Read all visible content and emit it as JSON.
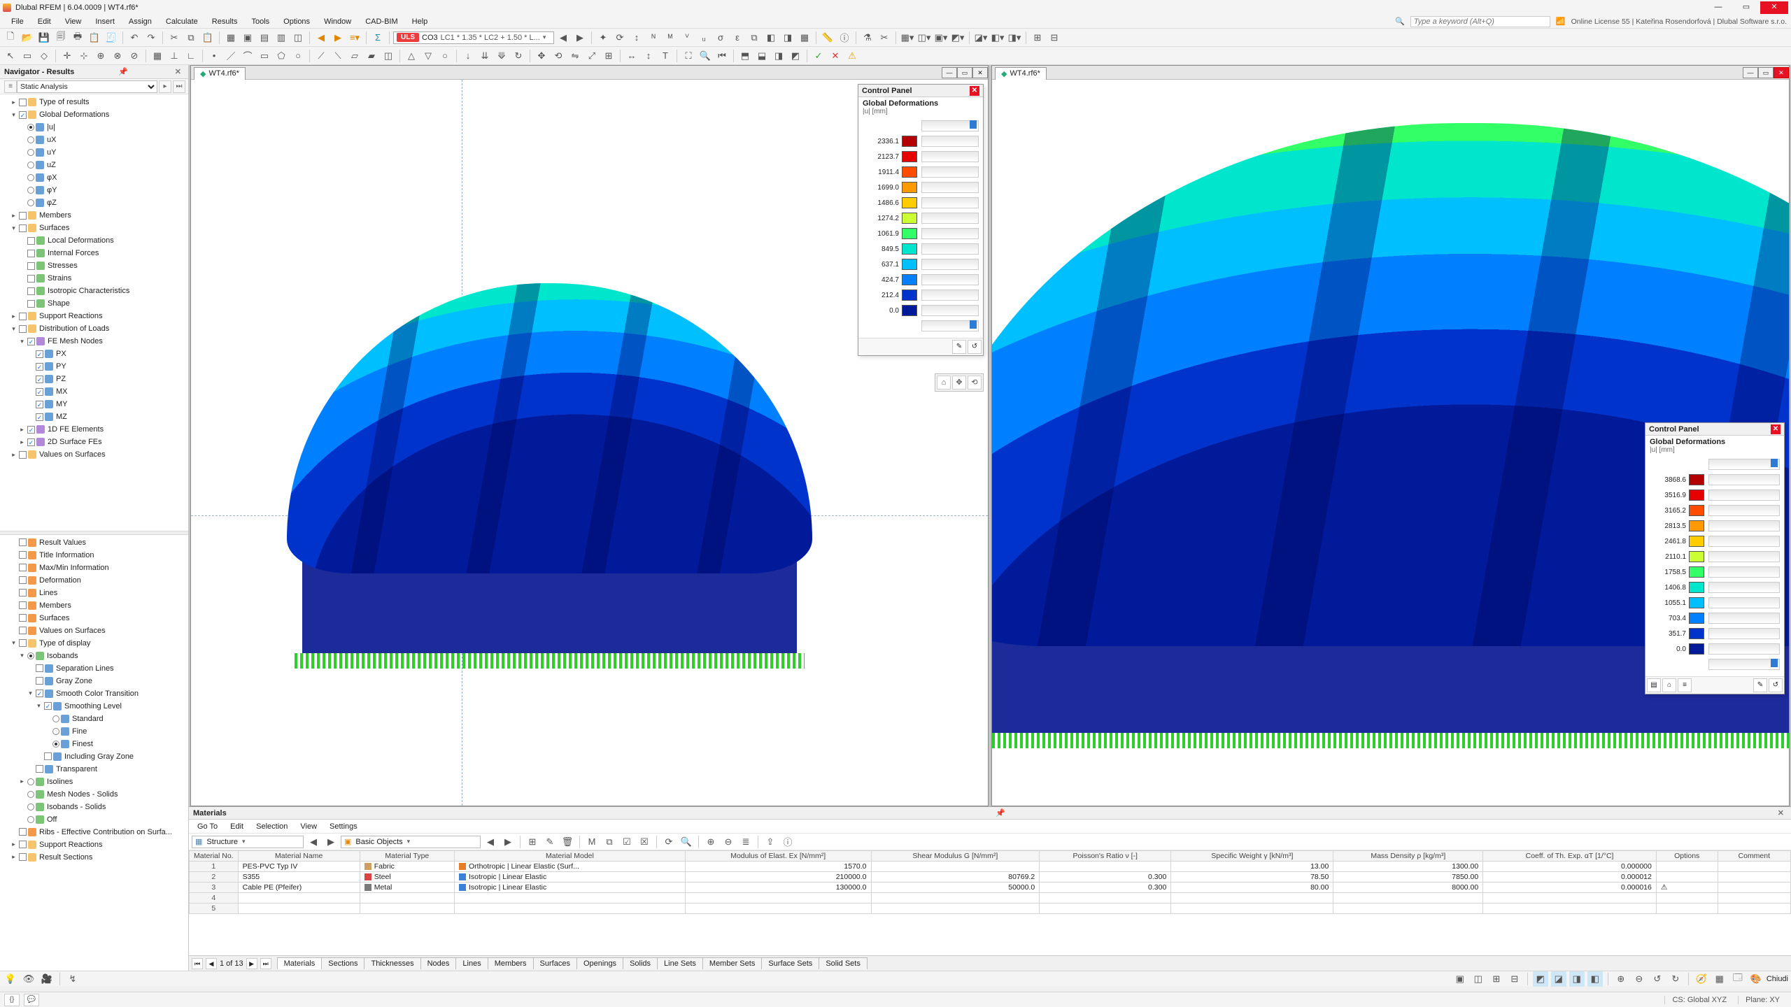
{
  "app": {
    "title": "Dlubal RFEM | 6.04.0009 | WT4.rf6*"
  },
  "license": "Online License 55 | Kateřina Rosendorfová | Dlubal Software s.r.o.",
  "search_placeholder": "Type a keyword (Alt+Q)",
  "menus": [
    "File",
    "Edit",
    "View",
    "Insert",
    "Assign",
    "Calculate",
    "Results",
    "Tools",
    "Options",
    "Window",
    "CAD-BIM",
    "Help"
  ],
  "load_combo": {
    "badge": "ULS",
    "code": "CO3",
    "text": "LC1 * 1.35 * LC2 + 1.50 * L..."
  },
  "navigator": {
    "title": "Navigator - Results",
    "analysis_type": "Static Analysis",
    "tree_top": [
      {
        "lvl": 1,
        "exp": ">",
        "chk": "",
        "ic": "folder",
        "lbl": "Type of results"
      },
      {
        "lvl": 1,
        "exp": "v",
        "chk": "c",
        "ic": "folder",
        "lbl": "Global Deformations"
      },
      {
        "lvl": 2,
        "radio": "c",
        "ic": "blue",
        "lbl": "|u|"
      },
      {
        "lvl": 2,
        "radio": "",
        "ic": "blue",
        "lbl": "uX"
      },
      {
        "lvl": 2,
        "radio": "",
        "ic": "blue",
        "lbl": "uY"
      },
      {
        "lvl": 2,
        "radio": "",
        "ic": "blue",
        "lbl": "uZ"
      },
      {
        "lvl": 2,
        "radio": "",
        "ic": "blue",
        "lbl": "φX"
      },
      {
        "lvl": 2,
        "radio": "",
        "ic": "blue",
        "lbl": "φY"
      },
      {
        "lvl": 2,
        "radio": "",
        "ic": "blue",
        "lbl": "φZ"
      },
      {
        "lvl": 1,
        "exp": ">",
        "chk": "",
        "ic": "folder",
        "lbl": "Members"
      },
      {
        "lvl": 1,
        "exp": "v",
        "chk": "",
        "ic": "folder",
        "lbl": "Surfaces"
      },
      {
        "lvl": 2,
        "chk": "",
        "ic": "green",
        "lbl": "Local Deformations"
      },
      {
        "lvl": 2,
        "chk": "",
        "ic": "green",
        "lbl": "Internal Forces"
      },
      {
        "lvl": 2,
        "chk": "",
        "ic": "green",
        "lbl": "Stresses"
      },
      {
        "lvl": 2,
        "chk": "",
        "ic": "green",
        "lbl": "Strains"
      },
      {
        "lvl": 2,
        "chk": "",
        "ic": "green",
        "lbl": "Isotropic Characteristics"
      },
      {
        "lvl": 2,
        "chk": "",
        "ic": "green",
        "lbl": "Shape"
      },
      {
        "lvl": 1,
        "exp": ">",
        "chk": "",
        "ic": "folder",
        "lbl": "Support Reactions"
      },
      {
        "lvl": 1,
        "exp": "v",
        "chk": "",
        "ic": "folder",
        "lbl": "Distribution of Loads"
      },
      {
        "lvl": 2,
        "exp": "v",
        "chk": "c",
        "ic": "mesh",
        "lbl": "FE Mesh Nodes"
      },
      {
        "lvl": 3,
        "chk": "c",
        "ic": "blue",
        "lbl": "PX"
      },
      {
        "lvl": 3,
        "chk": "c",
        "ic": "blue",
        "lbl": "PY"
      },
      {
        "lvl": 3,
        "chk": "c",
        "ic": "blue",
        "lbl": "PZ"
      },
      {
        "lvl": 3,
        "chk": "c",
        "ic": "blue",
        "lbl": "MX"
      },
      {
        "lvl": 3,
        "chk": "c",
        "ic": "blue",
        "lbl": "MY"
      },
      {
        "lvl": 3,
        "chk": "c",
        "ic": "blue",
        "lbl": "MZ"
      },
      {
        "lvl": 2,
        "exp": ">",
        "chk": "c",
        "ic": "mesh",
        "lbl": "1D FE Elements"
      },
      {
        "lvl": 2,
        "exp": ">",
        "chk": "c",
        "ic": "mesh",
        "lbl": "2D Surface FEs"
      },
      {
        "lvl": 1,
        "exp": ">",
        "chk": "",
        "ic": "folder",
        "lbl": "Values on Surfaces"
      }
    ],
    "tree_bottom": [
      {
        "lvl": 1,
        "chk": "",
        "ic": "orange",
        "lbl": "Result Values"
      },
      {
        "lvl": 1,
        "chk": "",
        "ic": "orange",
        "lbl": "Title Information"
      },
      {
        "lvl": 1,
        "chk": "",
        "ic": "orange",
        "lbl": "Max/Min Information"
      },
      {
        "lvl": 1,
        "chk": "",
        "ic": "orange",
        "lbl": "Deformation"
      },
      {
        "lvl": 1,
        "chk": "",
        "ic": "orange",
        "lbl": "Lines"
      },
      {
        "lvl": 1,
        "chk": "",
        "ic": "orange",
        "lbl": "Members"
      },
      {
        "lvl": 1,
        "chk": "",
        "ic": "orange",
        "lbl": "Surfaces"
      },
      {
        "lvl": 1,
        "chk": "",
        "ic": "orange",
        "lbl": "Values on Surfaces"
      },
      {
        "lvl": 1,
        "exp": "v",
        "chk": "",
        "ic": "folder",
        "lbl": "Type of display"
      },
      {
        "lvl": 2,
        "exp": "v",
        "radio": "c",
        "ic": "green",
        "lbl": "Isobands"
      },
      {
        "lvl": 3,
        "chk": "",
        "ic": "blue",
        "lbl": "Separation Lines"
      },
      {
        "lvl": 3,
        "chk": "",
        "ic": "blue",
        "lbl": "Gray Zone"
      },
      {
        "lvl": 3,
        "exp": "v",
        "chk": "c",
        "ic": "blue",
        "lbl": "Smooth Color Transition"
      },
      {
        "lvl": 4,
        "exp": "v",
        "chk": "c",
        "ic": "blue",
        "lbl": "Smoothing Level"
      },
      {
        "lvl": 5,
        "radio": "",
        "ic": "blue",
        "lbl": "Standard"
      },
      {
        "lvl": 5,
        "radio": "",
        "ic": "blue",
        "lbl": "Fine"
      },
      {
        "lvl": 5,
        "radio": "c",
        "ic": "blue",
        "lbl": "Finest"
      },
      {
        "lvl": 4,
        "chk": "",
        "ic": "blue",
        "lbl": "Including Gray Zone"
      },
      {
        "lvl": 3,
        "chk": "",
        "ic": "blue",
        "lbl": "Transparent"
      },
      {
        "lvl": 2,
        "exp": ">",
        "radio": "",
        "ic": "green",
        "lbl": "Isolines"
      },
      {
        "lvl": 2,
        "radio": "",
        "ic": "green",
        "lbl": "Mesh Nodes - Solids"
      },
      {
        "lvl": 2,
        "radio": "",
        "ic": "green",
        "lbl": "Isobands - Solids"
      },
      {
        "lvl": 2,
        "radio": "",
        "ic": "green",
        "lbl": "Off"
      },
      {
        "lvl": 1,
        "chk": "",
        "ic": "orange",
        "lbl": "Ribs - Effective Contribution on Surfa..."
      },
      {
        "lvl": 1,
        "exp": ">",
        "chk": "",
        "ic": "folder",
        "lbl": "Support Reactions"
      },
      {
        "lvl": 1,
        "exp": ">",
        "chk": "",
        "ic": "folder",
        "lbl": "Result Sections"
      }
    ]
  },
  "view": {
    "tab": "WT4.rf6*"
  },
  "control_panels": {
    "left": {
      "title": "Control Panel",
      "subtitle": "Global Deformations",
      "unit": "|u| [mm]",
      "values": [
        "2336.1",
        "2123.7",
        "1911.4",
        "1699.0",
        "1486.6",
        "1274.2",
        "1061.9",
        "849.5",
        "637.1",
        "424.7",
        "212.4",
        "0.0"
      ]
    },
    "right": {
      "title": "Control Panel",
      "subtitle": "Global Deformations",
      "unit": "|u| [mm]",
      "values": [
        "3868.6",
        "3516.9",
        "3165.2",
        "2813.5",
        "2461.8",
        "2110.1",
        "1758.5",
        "1406.8",
        "1055.1",
        "703.4",
        "351.7",
        "0.0"
      ]
    }
  },
  "scale_colors": [
    "#b30000",
    "#e60000",
    "#ff4d00",
    "#ff9900",
    "#ffcc00",
    "#ccff33",
    "#33ff66",
    "#00e6cc",
    "#00bfff",
    "#0080ff",
    "#0033cc",
    "#001a99"
  ],
  "materials": {
    "title": "Materials",
    "menus": [
      "Go To",
      "Edit",
      "Selection",
      "View",
      "Settings"
    ],
    "combo1": "Structure",
    "combo2": "Basic Objects",
    "headers": [
      "Material No.",
      "Material Name",
      "Material Type",
      "Material Model",
      "Modulus of Elast. Ex [N/mm²]",
      "Shear Modulus G [N/mm²]",
      "Poisson's Ratio ν [-]",
      "Specific Weight γ [kN/m³]",
      "Mass Density ρ [kg/m³]",
      "Coeff. of Th. Exp. αT [1/°C]",
      "Options",
      "Comment"
    ],
    "rows": [
      {
        "no": "1",
        "name": "PES-PVC Typ IV",
        "type": "Fabric",
        "type_c": "#cc9e5f",
        "model": "Orthotropic | Linear Elastic (Surf...",
        "model_c": "#e57e24",
        "E": "1570.0",
        "G": "",
        "nu": "",
        "gamma": "13.00",
        "rho": "1300.00",
        "alpha": "0.000000",
        "opt": "",
        "cmt": ""
      },
      {
        "no": "2",
        "name": "S355",
        "type": "Steel",
        "type_c": "#d94343",
        "model": "Isotropic | Linear Elastic",
        "model_c": "#3b82d6",
        "E": "210000.0",
        "G": "80769.2",
        "nu": "0.300",
        "gamma": "78.50",
        "rho": "7850.00",
        "alpha": "0.000012",
        "opt": "",
        "cmt": ""
      },
      {
        "no": "3",
        "name": "Cable PE (Pfeifer)",
        "type": "Metal",
        "type_c": "#7a7a7a",
        "model": "Isotropic | Linear Elastic",
        "model_c": "#3b82d6",
        "E": "130000.0",
        "G": "50000.0",
        "nu": "0.300",
        "gamma": "80.00",
        "rho": "8000.00",
        "alpha": "0.000016",
        "opt": "⚠",
        "cmt": ""
      },
      {
        "no": "4",
        "name": "",
        "type": "",
        "type_c": "",
        "model": "",
        "model_c": "",
        "E": "",
        "G": "",
        "nu": "",
        "gamma": "",
        "rho": "",
        "alpha": "",
        "opt": "",
        "cmt": ""
      },
      {
        "no": "5",
        "name": "",
        "type": "",
        "type_c": "",
        "model": "",
        "model_c": "",
        "E": "",
        "G": "",
        "nu": "",
        "gamma": "",
        "rho": "",
        "alpha": "",
        "opt": "",
        "cmt": ""
      }
    ],
    "pager": "1 of 13",
    "tabs": [
      "Materials",
      "Sections",
      "Thicknesses",
      "Nodes",
      "Lines",
      "Members",
      "Surfaces",
      "Openings",
      "Solids",
      "Line Sets",
      "Member Sets",
      "Surface Sets",
      "Solid Sets"
    ]
  },
  "status": {
    "cs": "CS: Global XYZ",
    "plane": "Plane: XY"
  }
}
